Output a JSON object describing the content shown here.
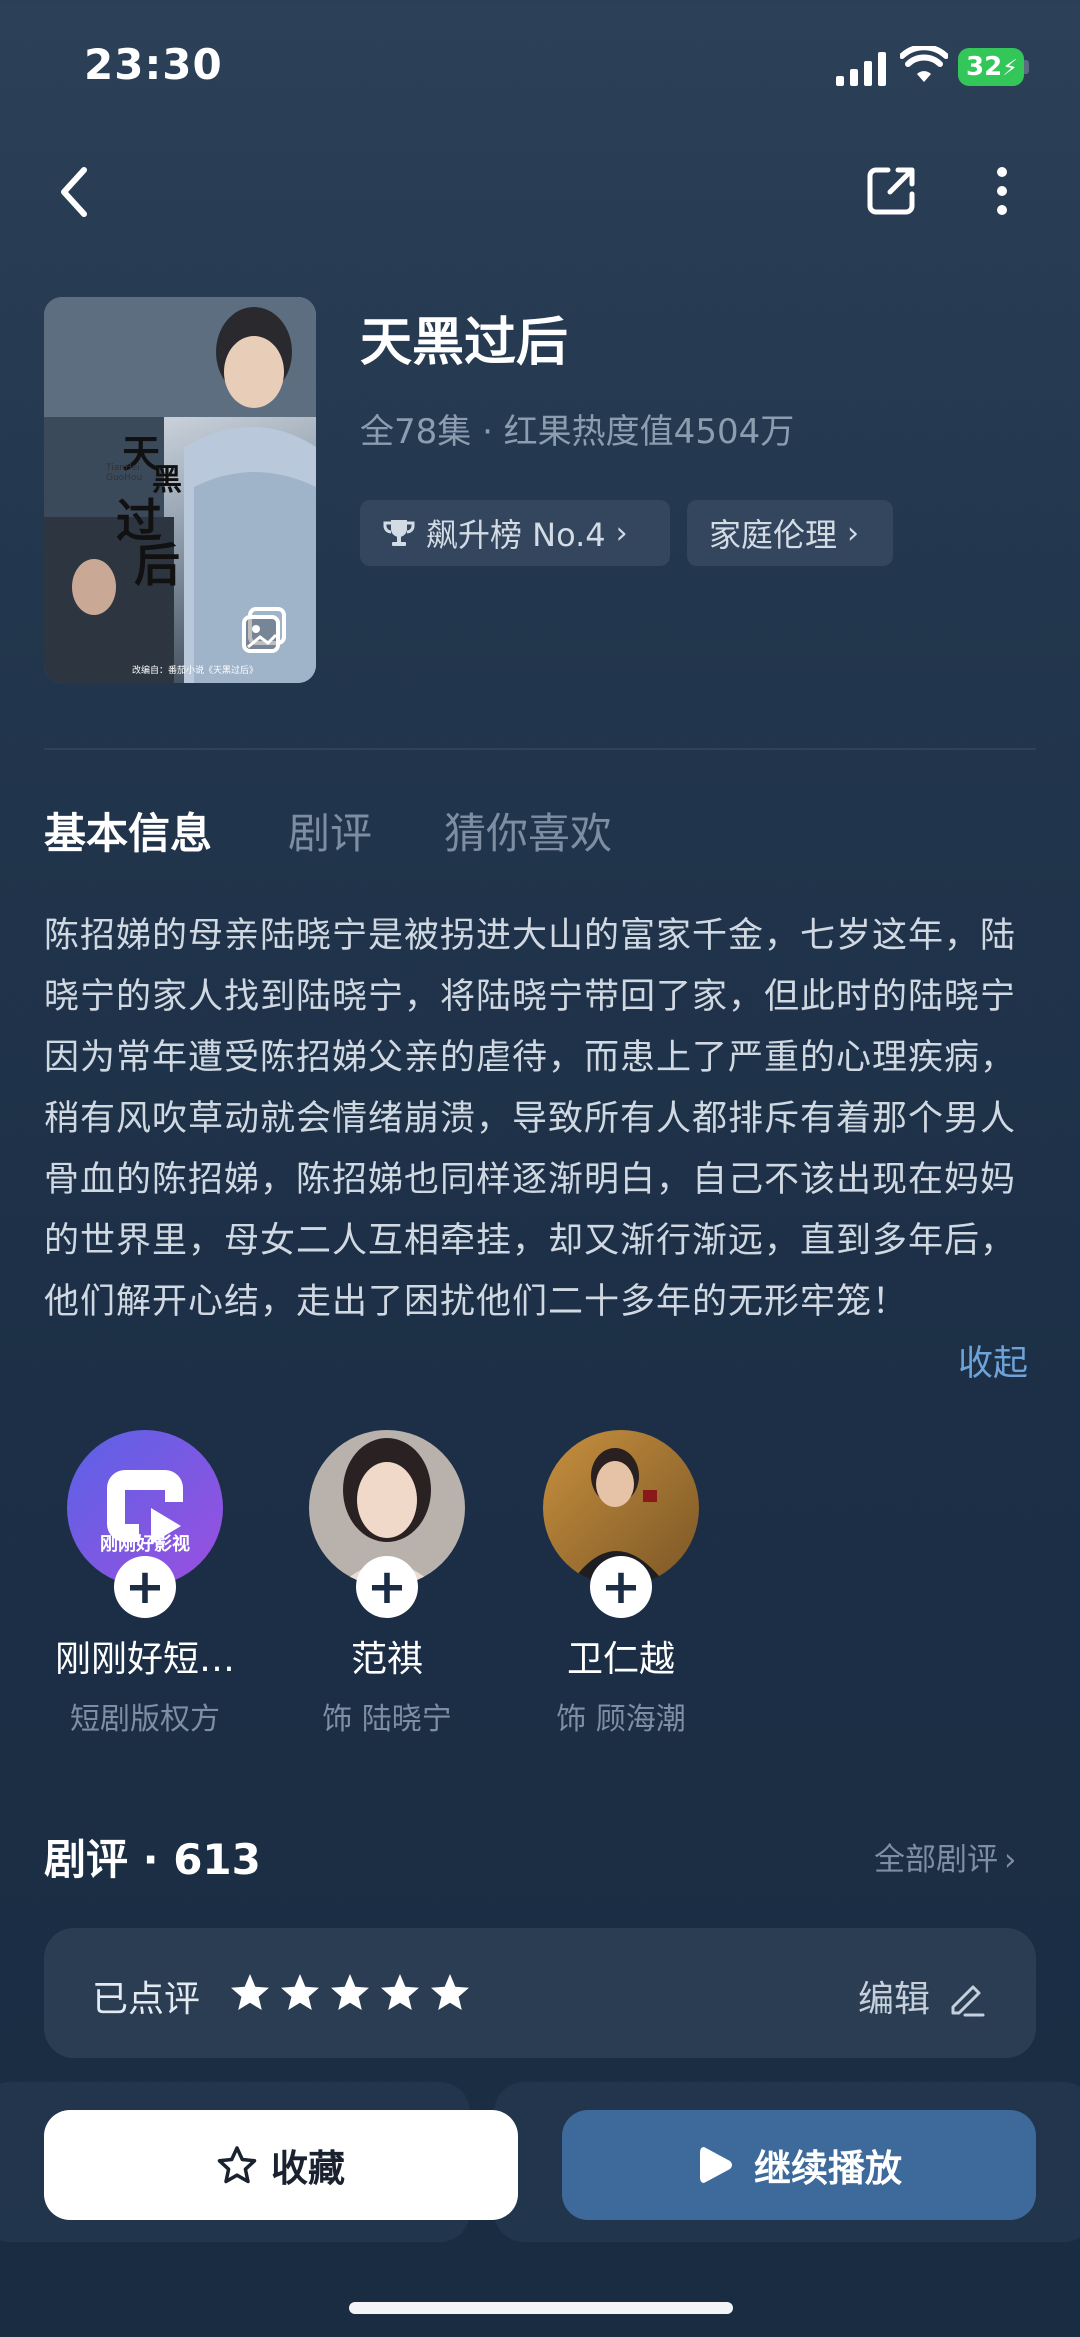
{
  "status_bar": {
    "time": "23:30",
    "battery": "32"
  },
  "drama": {
    "title": "天黑过后",
    "meta": "全78集 · 红果热度值4504万",
    "chips": [
      {
        "label": "飙升榜 No.4"
      },
      {
        "label": "家庭伦理"
      }
    ],
    "poster": {
      "title_chars": [
        "天",
        "黑",
        "过",
        "后"
      ],
      "pinyin": "TianHei GuoHou",
      "caption": "改编自：番茄小说《天黑过后》"
    }
  },
  "tabs": [
    {
      "label": "基本信息",
      "active": true
    },
    {
      "label": "剧评",
      "active": false
    },
    {
      "label": "猜你喜欢",
      "active": false
    }
  ],
  "description": {
    "text": "陈招娣的母亲陆晓宁是被拐进大山的富家千金，七岁这年，陆晓宁的家人找到陆晓宁，将陆晓宁带回了家，但此时的陆晓宁因为常年遭受陈招娣父亲的虐待，而患上了严重的心理疾病，稍有风吹草动就会情绪崩溃，导致所有人都排斥有着那个男人骨血的陈招娣，陈招娣也同样逐渐明白，自己不该出现在妈妈的世界里，母女二人互相牵挂，却又渐行渐远，直到多年后，他们解开心结，走出了困扰他们二十多年的无形牢笼！",
    "collapse_label": "收起"
  },
  "cast": [
    {
      "name": "刚刚好短…",
      "role": "短剧版权方",
      "logo_text": "刚刚好影视"
    },
    {
      "name": "范祺",
      "role": "饰 陆晓宁"
    },
    {
      "name": "卫仁越",
      "role": "饰 顾海潮"
    }
  ],
  "reviews": {
    "title": "剧评 · 613",
    "all_label": "全部剧评",
    "rated_label": "已点评",
    "stars": 5,
    "edit_label": "编辑"
  },
  "actions": {
    "favorite_label": "收藏",
    "play_label": "继续播放"
  },
  "colors": {
    "accent_blue": "#3d6a9b",
    "link_blue": "#6fa2d6",
    "battery_green": "#33c759"
  }
}
